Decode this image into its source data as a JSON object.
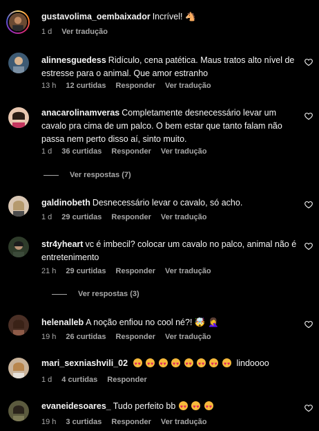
{
  "comments": [
    {
      "user": "gustavolima_oembaixador",
      "text": "Incrível! 🐴",
      "time": "1 d",
      "likes": "",
      "reply": "",
      "translate": "Ver tradução"
    },
    {
      "user": "alinnesguedess",
      "text": "Ridículo, cena patética. Maus tratos alto nível de estresse para o animal. Que amor estranho",
      "time": "13 h",
      "likes": "12 curtidas",
      "reply": "Responder",
      "translate": "Ver tradução"
    },
    {
      "user": "anacarolinamveras",
      "text": "Completamente desnecessário levar um cavalo pra cima de um palco. O bem estar que tanto falam não passa nem perto disso aí, sinto muito.",
      "time": "1 d",
      "likes": "36 curtidas",
      "reply": "Responder",
      "translate": "Ver tradução",
      "more_replies": "Ver respostas (7)"
    },
    {
      "user": "galdinobeth",
      "text": "Desnecessário levar o cavalo, só acho.",
      "time": "1 d",
      "likes": "29 curtidas",
      "reply": "Responder",
      "translate": "Ver tradução"
    },
    {
      "user": "str4yheart",
      "text": "vc é imbecil? colocar um cavalo no palco, animal não é entretenimento",
      "time": "21 h",
      "likes": "29 curtidas",
      "reply": "Responder",
      "translate": "Ver tradução",
      "more_replies": "Ver respostas (3)"
    },
    {
      "user": "helenalleb",
      "text": "A noção enfiou no cool né?! 🤯 🤦‍♀️",
      "time": "19 h",
      "likes": "26 curtidas",
      "reply": "Responder",
      "translate": "Ver tradução"
    },
    {
      "user": "mari_sexniashvili_02",
      "text": "lindoooo",
      "time": "1 d",
      "likes": "4 curtidas",
      "reply": "Responder",
      "translate": ""
    },
    {
      "user": "evaneidesoares_",
      "text": "Tudo perfeito bb",
      "time": "19 h",
      "likes": "3 curtidas",
      "reply": "Responder",
      "translate": "Ver tradução"
    }
  ],
  "icons": {
    "like": "heart-outline-icon"
  },
  "colors": {
    "background": "#000000",
    "text": "#f5f5f5",
    "muted": "#a8a8a8"
  }
}
